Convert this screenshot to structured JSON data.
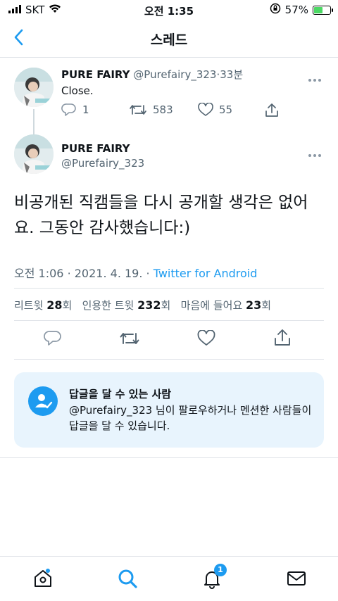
{
  "status_bar": {
    "carrier": "SKT",
    "time": "오전 1:35",
    "battery_text": "57%",
    "battery_level": 0.57
  },
  "nav": {
    "title": "스레드"
  },
  "parent_tweet": {
    "name": "PURE FAIRY",
    "handle": "@Purefairy_323",
    "separator": "·",
    "age": "33분",
    "text": "Close.",
    "replies": "1",
    "retweets": "583",
    "likes": "55"
  },
  "main_tweet": {
    "name": "PURE FAIRY",
    "handle": "@Purefairy_323",
    "text": "비공개된 직캠들을 다시 공개할 생각은 없어요. 그동안 감사했습니다:)",
    "time": "오전 1:06",
    "date": "2021. 4. 19.",
    "meta_separator": "·",
    "source": "Twitter for Android",
    "stats": {
      "retweets_label": "리트윗",
      "retweets": "28",
      "quotes_label": "인용한 트윗",
      "quotes": "232",
      "likes_label": "마음에 들어요",
      "likes": "23",
      "unit": "회"
    }
  },
  "reply_card": {
    "title": "답글을 달 수 있는 사람",
    "body": "@Purefairy_323 님이 팔로우하거나 멘션한 사람들이 답글을 달 수 있습니다."
  },
  "tab_bar": {
    "notification_count": "1"
  },
  "colors": {
    "accent": "#1d9bf0",
    "text": "#0f1419",
    "muted": "#536471",
    "card_bg": "#e8f4fd"
  }
}
